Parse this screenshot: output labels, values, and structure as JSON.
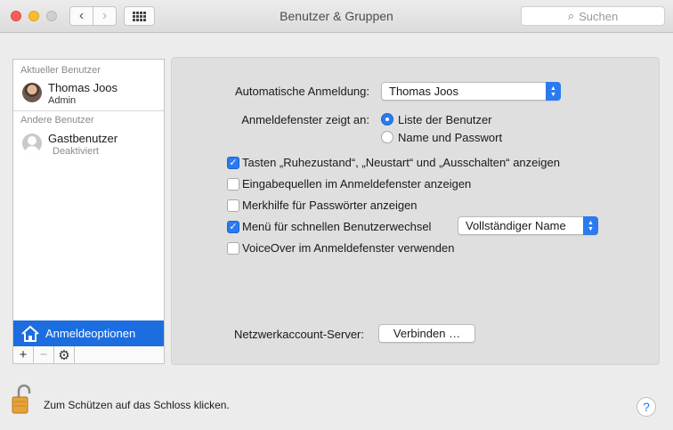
{
  "window": {
    "title": "Benutzer & Gruppen"
  },
  "toolbar": {
    "back_glyph": "‹",
    "forward_glyph": "›",
    "search_placeholder": "Suchen",
    "search_icon_glyph": "⌕"
  },
  "sidebar": {
    "current_section": "Aktueller Benutzer",
    "current_user": {
      "name": "Thomas Joos",
      "role": "Admin"
    },
    "other_section": "Andere Benutzer",
    "other_users": [
      {
        "name": "Gastbenutzer",
        "status": "Deaktiviert"
      }
    ],
    "selected_item": "Anmeldeoptionen",
    "tools": {
      "add": "+",
      "remove": "−",
      "settings": "⚙"
    }
  },
  "options": {
    "auto_login": {
      "label": "Automatische Anmeldung:",
      "value": "Thomas Joos"
    },
    "login_window": {
      "label": "Anmeldefenster zeigt an:",
      "choices": [
        {
          "label": "Liste der Benutzer",
          "selected": true
        },
        {
          "label": "Name und Passwort",
          "selected": false
        }
      ]
    },
    "checkboxes": [
      {
        "label": "Tasten „Ruhezustand“, „Neustart“ und „Ausschalten“ anzeigen",
        "checked": true
      },
      {
        "label": "Eingabequellen im Anmeldefenster anzeigen",
        "checked": false
      },
      {
        "label": "Merkhilfe für Passwörter anzeigen",
        "checked": false
      },
      {
        "label": "Menü für schnellen Benutzerwechsel",
        "checked": true
      },
      {
        "label": "VoiceOver im Anmeldefenster verwenden",
        "checked": false
      }
    ],
    "fast_switch_display": "Vollständiger Name",
    "network_server": {
      "label": "Netzwerkaccount-Server:",
      "button": "Verbinden …"
    }
  },
  "footer": {
    "lock_text": "Zum Schützen auf das Schloss klicken.",
    "help": "?"
  },
  "colors": {
    "accent": "#2a7bef",
    "selection": "#1b6de0"
  }
}
